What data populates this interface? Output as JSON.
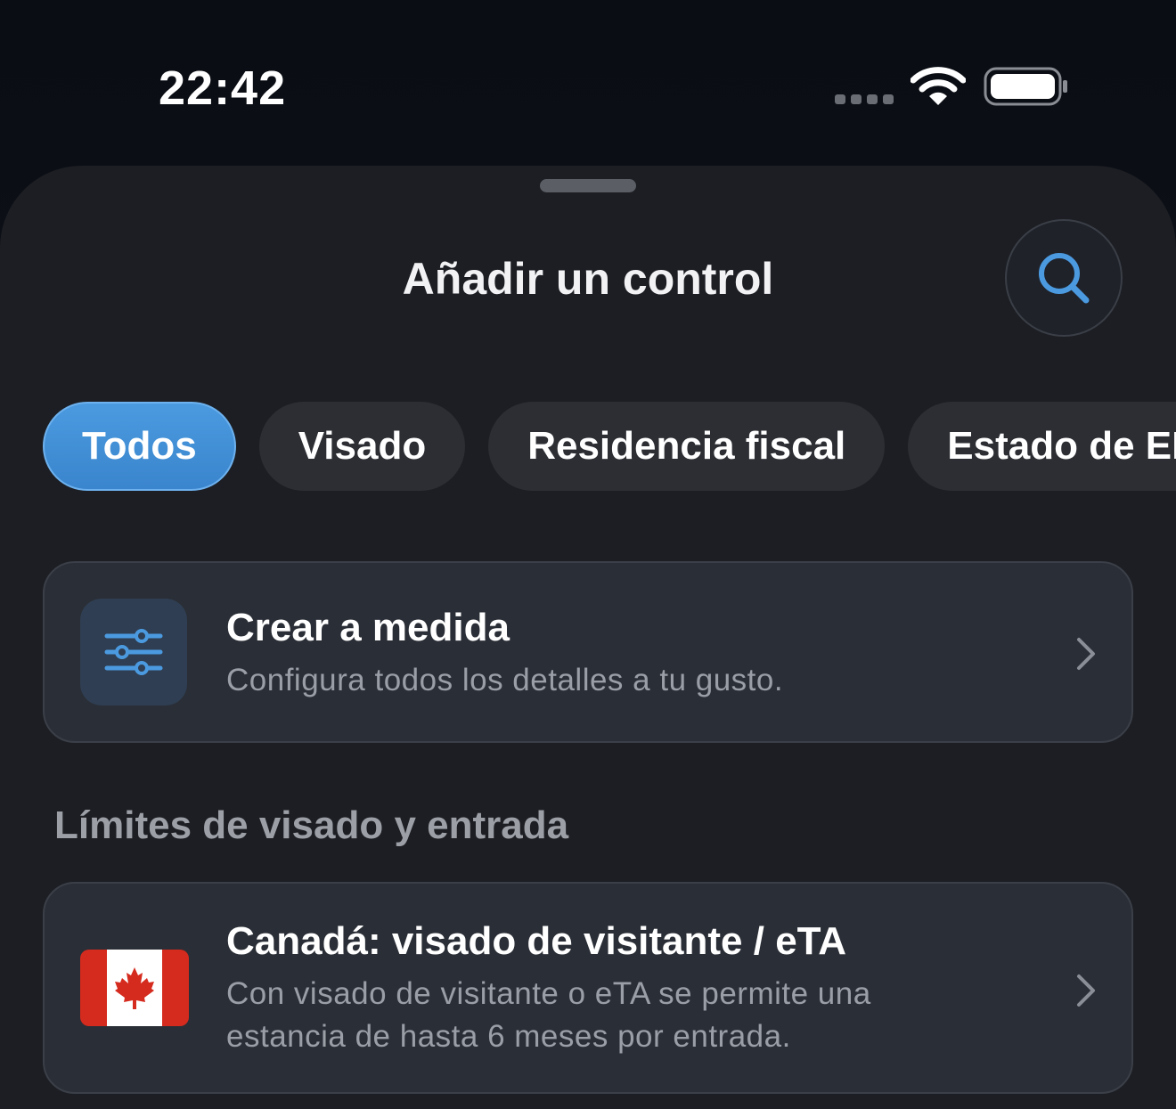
{
  "status_bar": {
    "time": "22:42"
  },
  "sheet": {
    "title": "Añadir un control"
  },
  "chips": [
    {
      "label": "Todos",
      "active": true
    },
    {
      "label": "Visado",
      "active": false
    },
    {
      "label": "Residencia fiscal",
      "active": false
    },
    {
      "label": "Estado de EE",
      "active": false
    }
  ],
  "custom_card": {
    "title": "Crear a medida",
    "description": "Configura todos los detalles a tu gusto.",
    "icon": "sliders-icon"
  },
  "section": {
    "label": "Límites de visado y entrada"
  },
  "items": [
    {
      "title": "Canadá: visado de visitante / eTA",
      "description_line1": "Con visado de visitante o eTA se permite una",
      "description_line2": "estancia de hasta 6 meses por entrada.",
      "icon": "canada-flag-icon"
    }
  ],
  "colors": {
    "accent": "#4b9ae0",
    "background": "#1c1e23",
    "card": "#2a2e36",
    "flag_red": "#d52b1e"
  }
}
